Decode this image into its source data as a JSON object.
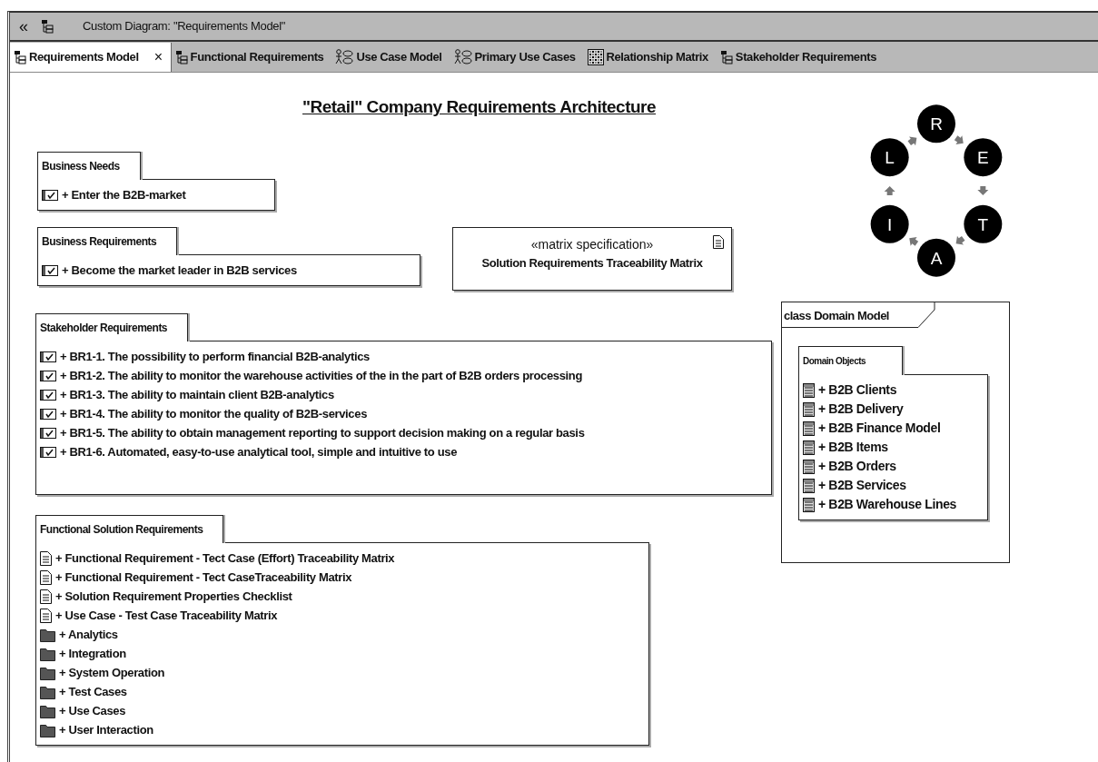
{
  "editor": {
    "collapse_glyph": "«",
    "title": "Custom Diagram: \"Requirements Model\""
  },
  "tabs": [
    {
      "label": "Requirements Model",
      "kind": "diagram",
      "selected": true,
      "close": "×"
    },
    {
      "label": "Functional Requirements",
      "kind": "diagram",
      "selected": false
    },
    {
      "label": "Use Case Model",
      "kind": "usecase",
      "selected": false
    },
    {
      "label": "Primary Use Cases",
      "kind": "usecase",
      "selected": false
    },
    {
      "label": "Relationship Matrix",
      "kind": "matrix",
      "selected": false
    },
    {
      "label": "Stakeholder Requirements",
      "kind": "diagram",
      "selected": false
    }
  ],
  "diagram": {
    "title": "\"Retail\" Company Requirements Architecture",
    "packages": [
      {
        "title": "Business Needs",
        "items": [
          {
            "text": "+ Enter the B2B-market",
            "kind": "requirement"
          }
        ]
      },
      {
        "title": "Business Requirements",
        "items": [
          {
            "text": "+ Become the market leader in B2B services",
            "kind": "requirement"
          }
        ]
      },
      {
        "title": "Stakeholder Requirements",
        "items": [
          {
            "text": "+ BR1-1. The possibility to perform financial B2B-analytics",
            "kind": "requirement"
          },
          {
            "text": "+ BR1-2. The ability to monitor the warehouse activities of the in the part of B2B orders processing",
            "kind": "requirement"
          },
          {
            "text": "+ BR1-3. The ability to maintain client B2B-analytics",
            "kind": "requirement"
          },
          {
            "text": "+ BR1-4. The ability to monitor the quality of B2B-services",
            "kind": "requirement"
          },
          {
            "text": "+ BR1-5. The ability to obtain management reporting to support decision making on a regular basis",
            "kind": "requirement"
          },
          {
            "text": "+ BR1-6. Automated, easy-to-use analytical tool, simple and intuitive to use",
            "kind": "requirement"
          }
        ]
      },
      {
        "title": "Functional Solution Requirements",
        "items": [
          {
            "text": "+ Functional Requirement - Tect Case (Effort) Traceability Matrix",
            "kind": "document"
          },
          {
            "text": "+ Functional Requirement - Tect CaseTraceability Matrix",
            "kind": "document"
          },
          {
            "text": "+ Solution Requirement Properties Checklist",
            "kind": "document"
          },
          {
            "text": "+ Use Case - Test Case Traceability Matrix",
            "kind": "document"
          },
          {
            "text": "+ Analytics",
            "kind": "folder"
          },
          {
            "text": "+ Integration",
            "kind": "folder"
          },
          {
            "text": "+ System Operation",
            "kind": "folder"
          },
          {
            "text": "+ Test Cases",
            "kind": "folder"
          },
          {
            "text": "+ Use Cases",
            "kind": "folder"
          },
          {
            "text": "+ User Interaction",
            "kind": "folder"
          }
        ]
      }
    ],
    "matrix_spec": {
      "stereotype": "«matrix specification»",
      "name": "Solution Requirements Traceability Matrix"
    },
    "cycle": [
      "R",
      "E",
      "T",
      "A",
      "I",
      "L"
    ],
    "domain_frame": {
      "title": "class Domain Model",
      "package": {
        "title": "Domain Objects",
        "items": [
          {
            "text": "+ B2B Clients",
            "kind": "class"
          },
          {
            "text": "+ B2B Delivery",
            "kind": "class"
          },
          {
            "text": "+ B2B Finance Model",
            "kind": "class"
          },
          {
            "text": "+ B2B Items",
            "kind": "class"
          },
          {
            "text": "+ B2B Orders",
            "kind": "class"
          },
          {
            "text": "+ B2B Services",
            "kind": "class"
          },
          {
            "text": "+ B2B Warehouse Lines",
            "kind": "class"
          }
        ]
      }
    }
  }
}
